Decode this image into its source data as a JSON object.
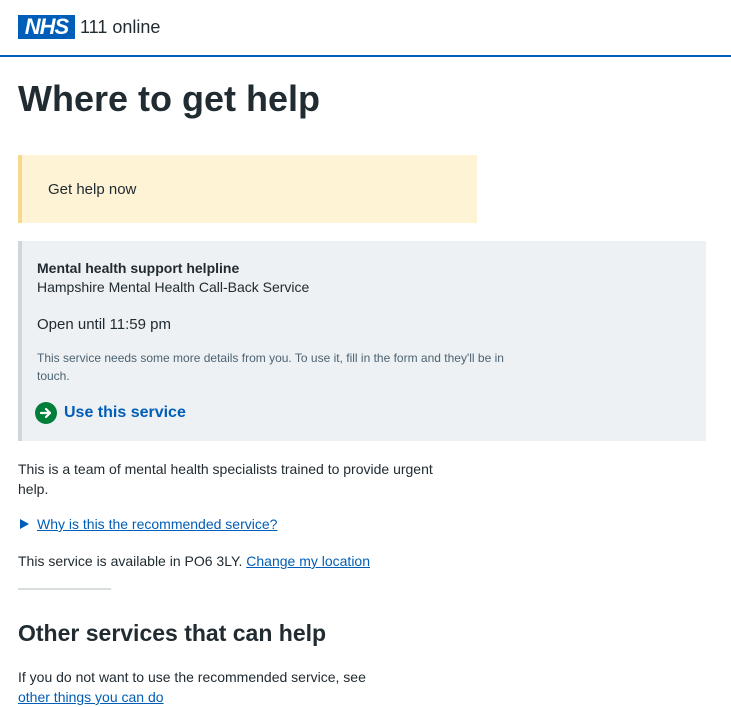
{
  "header": {
    "logo_text": "NHS",
    "service_name": "111 online",
    "brand_color": "#005eb8"
  },
  "page": {
    "title": "Where to get help"
  },
  "callout": {
    "text": "Get help now",
    "background": "#fff3d6"
  },
  "service_card": {
    "type": "Mental health support helpline",
    "name": "Hampshire Mental Health Call-Back Service",
    "hours": "Open until 11:59 pm",
    "note": "This service needs some more details from you. To use it, fill in the form and they'll be in touch.",
    "cta_label": "Use this service",
    "cta_icon": "arrow-right-circle-icon",
    "cta_icon_color": "#007f3b"
  },
  "description": "This is a team of mental health specialists trained to provide urgent help.",
  "details": {
    "summary": "Why is this the recommended service?"
  },
  "availability": {
    "text": "This service is available in PO6 3LY.",
    "link": "Change my location"
  },
  "other_services": {
    "heading": "Other services that can help",
    "text": "If you do not want to use the recommended service, see",
    "link": "other things you can do"
  }
}
